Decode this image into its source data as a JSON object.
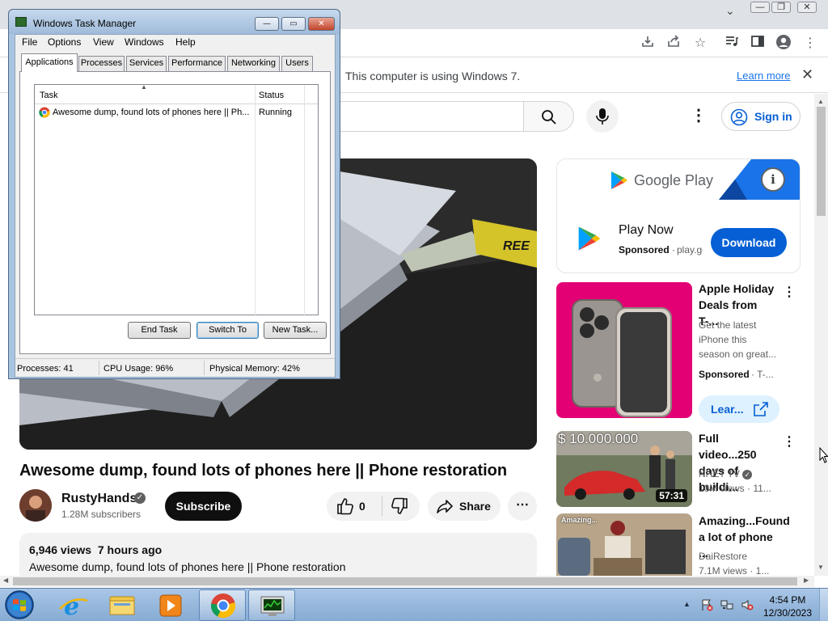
{
  "chrome": {
    "infobar_text": "This computer is using Windows 7.",
    "infobar_link": "Learn more",
    "toolbar_icons": [
      "download-icon",
      "share-icon",
      "bookmark-star-icon",
      "media-control-icon",
      "side-panel-icon",
      "profile-icon",
      "chrome-menu-icon"
    ]
  },
  "youtube": {
    "signin_label": "Sign in",
    "video_title": "Awesome dump, found lots of phones here || Phone restoration",
    "channel": {
      "name": "RustyHands",
      "subscribers": "1.28M subscribers",
      "subscribe_label": "Subscribe"
    },
    "actions": {
      "like_count": "0",
      "share_label": "Share"
    },
    "description": {
      "views": "6,946 views",
      "time": "7 hours ago",
      "text": "Awesome dump, found lots of phones here || Phone restoration"
    },
    "ad": {
      "brand": "Google Play",
      "headline": "Play Now",
      "sponsored": "Sponsored",
      "dot": "·",
      "domain": "play.google.com",
      "cta": "Download"
    },
    "recommendations": [
      {
        "title": "Apple Holiday Deals from T-...",
        "description": "Get the latest iPhone this season on great...",
        "sponsored": "Sponsored",
        "dot": "· T-...",
        "cta": "Lear..."
      },
      {
        "title": "Full video...250 days of buildi...",
        "channel": "NHẾT TV",
        "meta": "10M views · 11...",
        "duration": "57:31",
        "overlay_text": "$ 10.000.000"
      },
      {
        "title": "Amazing...Found a lot of phone ...",
        "channel": "DaiRestore",
        "meta": "7.1M views · 1...",
        "overlay_text": "Amazing..."
      }
    ],
    "colors": {
      "brand_blue": "#065fd4",
      "tmobile_magenta": "#e20074",
      "subscribe_black": "#0f0f0f"
    }
  },
  "taskmanager": {
    "title": "Windows Task Manager",
    "menu": [
      "File",
      "Options",
      "View",
      "Windows",
      "Help"
    ],
    "tabs": [
      "Applications",
      "Processes",
      "Services",
      "Performance",
      "Networking",
      "Users"
    ],
    "columns": [
      "Task",
      "Status"
    ],
    "rows": [
      {
        "task": "Awesome dump, found lots of phones here || Ph...",
        "status": "Running"
      }
    ],
    "buttons": [
      "End Task",
      "Switch To",
      "New Task..."
    ],
    "status": {
      "processes": "Processes: 41",
      "cpu": "CPU Usage: 96%",
      "memory": "Physical Memory: 42%"
    }
  },
  "taskbar": {
    "apps": [
      "start-orb",
      "internet-explorer-icon",
      "file-explorer-icon",
      "media-player-icon",
      "chrome-icon",
      "task-manager-icon"
    ],
    "clock_time": "4:54 PM",
    "clock_date": "12/30/2023"
  }
}
